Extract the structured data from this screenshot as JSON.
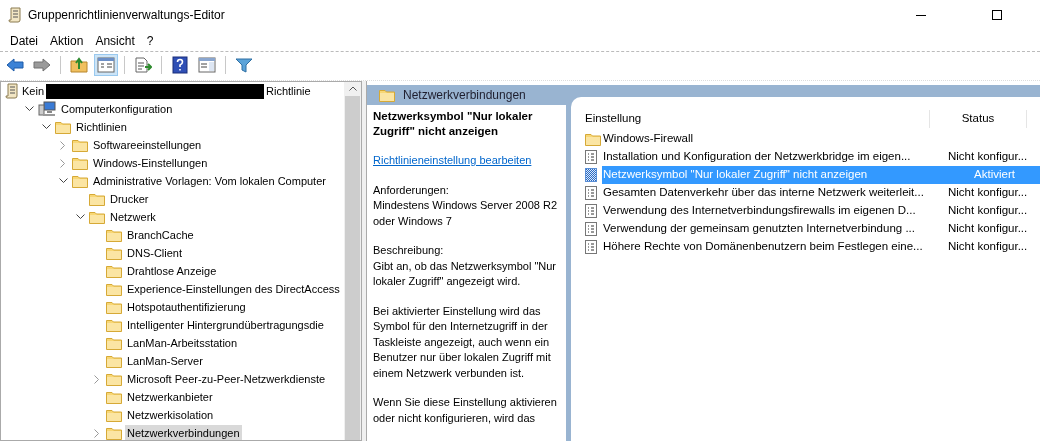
{
  "window": {
    "title": "Gruppenrichtlinienverwaltungs-Editor"
  },
  "menu": [
    "Datei",
    "Aktion",
    "Ansicht",
    "?"
  ],
  "toolbar": [
    {
      "kind": "back",
      "pressed": false
    },
    {
      "kind": "forward",
      "pressed": false
    },
    {
      "kind": "sep"
    },
    {
      "kind": "up",
      "pressed": false
    },
    {
      "kind": "tree",
      "pressed": true
    },
    {
      "kind": "sep"
    },
    {
      "kind": "export",
      "pressed": false
    },
    {
      "kind": "sep"
    },
    {
      "kind": "help",
      "pressed": false
    },
    {
      "kind": "pane",
      "pressed": false
    },
    {
      "kind": "sep"
    },
    {
      "kind": "filter",
      "pressed": false
    }
  ],
  "tree": [
    {
      "kind": "policy",
      "label_start": "Kein",
      "label_end": "Richtlinie",
      "selected": false,
      "children": [
        {
          "kind": "computer",
          "label": "Computerkonfiguration",
          "expanded": true,
          "selected": false,
          "children": [
            {
              "kind": "folder",
              "label": "Richtlinien",
              "expanded": true,
              "selected": false,
              "children": [
                {
                  "kind": "folder",
                  "label": "Softwareeinstellungen",
                  "expanded": false,
                  "selected": false
                },
                {
                  "kind": "folder",
                  "label": "Windows-Einstellungen",
                  "expanded": false,
                  "selected": false
                },
                {
                  "kind": "folder",
                  "label": "Administrative Vorlagen: Vom lokalen Computer",
                  "expanded": true,
                  "selected": false,
                  "children": [
                    {
                      "kind": "folder",
                      "label": "Drucker",
                      "selected": false
                    },
                    {
                      "kind": "folder",
                      "label": "Netzwerk",
                      "expanded": true,
                      "selected": false,
                      "children": [
                        {
                          "kind": "folder",
                          "label": "BranchCache",
                          "selected": false
                        },
                        {
                          "kind": "folder",
                          "label": "DNS-Client",
                          "selected": false
                        },
                        {
                          "kind": "folder",
                          "label": "Drahtlose Anzeige",
                          "selected": false
                        },
                        {
                          "kind": "folder",
                          "label": "Experience-Einstellungen des DirectAccess",
                          "selected": false
                        },
                        {
                          "kind": "folder",
                          "label": "Hotspotauthentifizierung",
                          "selected": false
                        },
                        {
                          "kind": "folder",
                          "label": "Intelligenter Hintergrundübertragungsdie",
                          "selected": false
                        },
                        {
                          "kind": "folder",
                          "label": "LanMan-Arbeitsstation",
                          "selected": false
                        },
                        {
                          "kind": "folder",
                          "label": "LanMan-Server",
                          "selected": false
                        },
                        {
                          "kind": "folder",
                          "label": "Microsoft Peer-zu-Peer-Netzwerkdienste",
                          "expanded": false,
                          "selected": false
                        },
                        {
                          "kind": "folder",
                          "label": "Netzwerkanbieter",
                          "selected": false
                        },
                        {
                          "kind": "folder",
                          "label": "Netzwerkisolation",
                          "selected": false
                        },
                        {
                          "kind": "folder",
                          "label": "Netzwerkverbindungen",
                          "expanded": false,
                          "selected": true
                        }
                      ]
                    }
                  ]
                }
              ]
            }
          ]
        }
      ]
    }
  ],
  "header": {
    "title": "Netzwerkverbindungen"
  },
  "description": {
    "title": "Netzwerksymbol \"Nur lokaler Zugriff\" nicht anzeigen",
    "link": "Richtlinieneinstellung bearbeiten",
    "paragraphs": [
      "Anforderungen:\nMindestens Windows Server 2008 R2 oder Windows 7",
      "Beschreibung:\nGibt an, ob das Netzwerksymbol \"Nur lokaler Zugriff\" angezeigt wird.",
      "Bei aktivierter Einstellung wird das Symbol für den Internetzugriff in der Taskleiste angezeigt, auch wenn ein Benutzer nur über lokalen Zugriff mit einem Netzwerk verbunden ist.",
      "Wenn Sie diese Einstellung aktivieren oder nicht konfigurieren, wird das"
    ]
  },
  "table": {
    "columns": [
      "Einstellung",
      "Status"
    ],
    "rows": [
      {
        "kind": "folder",
        "name": "Windows-Firewall",
        "selected": false
      },
      {
        "kind": "setting",
        "name": "Installation und Konfiguration der Netzwerkbridge im eigen...",
        "status": "Nicht konfigur...",
        "selected": false
      },
      {
        "kind": "enabled",
        "name": "Netzwerksymbol \"Nur lokaler Zugriff\" nicht anzeigen",
        "status": "Aktiviert",
        "selected": true
      },
      {
        "kind": "setting",
        "name": "Gesamten Datenverkehr über das interne Netzwerk weiterleit...",
        "status": "Nicht konfigur...",
        "selected": false
      },
      {
        "kind": "setting",
        "name": "Verwendung des Internetverbindungsfirewalls im eigenen D...",
        "status": "Nicht konfigur...",
        "selected": false
      },
      {
        "kind": "setting",
        "name": "Verwendung der gemeinsam genutzten Internetverbindung ...",
        "status": "Nicht konfigur...",
        "selected": false
      },
      {
        "kind": "setting",
        "name": "Höhere Rechte von Domänenbenutzern beim Festlegen eine...",
        "status": "Nicht konfigur...",
        "selected": false
      }
    ]
  }
}
